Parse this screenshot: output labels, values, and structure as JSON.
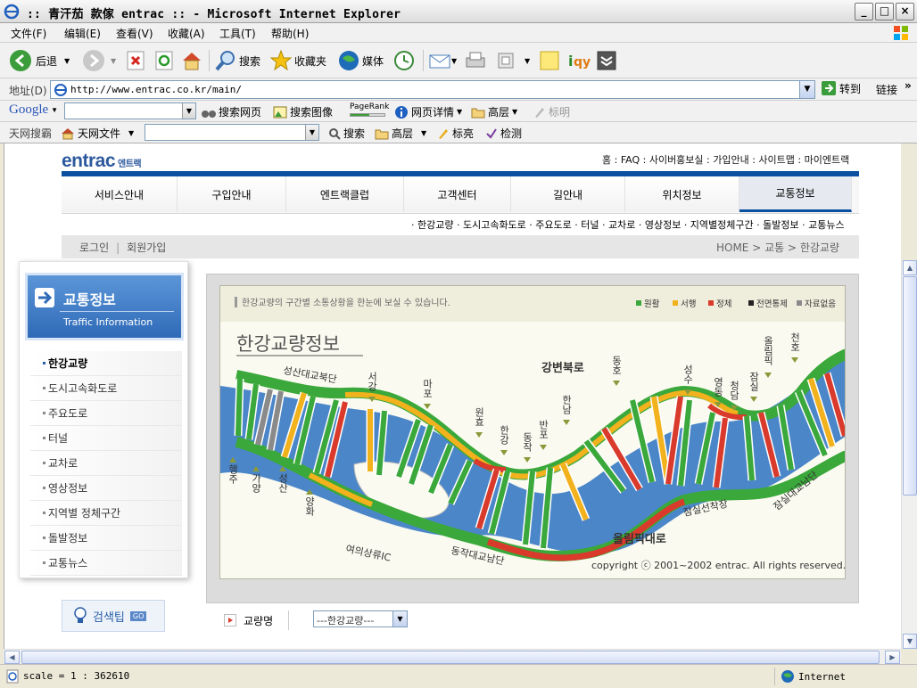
{
  "window": {
    "title": ":: 青汗茄 款傢 entrac :: - Microsoft Internet Explorer",
    "buttons": {
      "minimize": "_",
      "maximize": "□",
      "close": "×"
    }
  },
  "menu": [
    "文件(F)",
    "编辑(E)",
    "查看(V)",
    "收藏(A)",
    "工具(T)",
    "帮助(H)"
  ],
  "toolbar": {
    "back": "后退",
    "search": "搜索",
    "favorites": "收藏夹",
    "media": "媒体"
  },
  "address": {
    "label": "地址(D)",
    "url": "http://www.entrac.co.kr/main/",
    "go": "转到",
    "links": "链接"
  },
  "google_bar": {
    "brand": "Google",
    "search_web": "搜索网页",
    "search_images": "搜索图像",
    "pagerank": "PageRank",
    "page_info": "网页详情",
    "highlight": "高层",
    "bookmark": "标明"
  },
  "tianwang_bar": {
    "label": "天网搜霸",
    "files": "天网文件",
    "search": "搜索",
    "highlight": "高层",
    "mark": "标亮",
    "check": "检测"
  },
  "site": {
    "logo": "entrac",
    "logo_sub": "엔트랙",
    "top_links": "홈 : FAQ : 사이버홍보실 : 가입안내 : 사이트맵 : 마이엔트랙",
    "nav": [
      "서비스안내",
      "구입안내",
      "엔트랙클럽",
      "고객센터",
      "길안내",
      "위치정보",
      "교통정보"
    ],
    "active_nav": "교통정보",
    "subnav": "· 한강교량 · 도시고속화도로 · 주요도로 · 터널 · 교차로 · 영상정보 · 지역별정체구간 · 돌발정보 · 교통뉴스",
    "login": "로그인",
    "signup": "회원가입",
    "breadcrumb": "HOME > 교통 > 한강교량",
    "side_title_ko": "교통정보",
    "side_title_en": "Traffic Information",
    "side_items": [
      "한강교량",
      "도시고속화도로",
      "주요도로",
      "터널",
      "교차로",
      "영상정보",
      "지역별 정체구간",
      "돌발정보",
      "교통뉴스"
    ],
    "search_tip": "검색팁",
    "search_tip_go": "GO",
    "bridge_label": "교량명",
    "bridge_select": "---한강교량---"
  },
  "map": {
    "title": "한강교량정보",
    "intro": "한강교량의 구간별 소통상황을 한눈에 보실 수 있습니다.",
    "legend": [
      {
        "label": "원활",
        "color": "#3aa83a"
      },
      {
        "label": "서행",
        "color": "#f2b21d"
      },
      {
        "label": "정체",
        "color": "#d93a2b"
      },
      {
        "label": "전면통제",
        "color": "#222222"
      },
      {
        "label": "자료없음",
        "color": "#8a8a8a"
      }
    ],
    "roads": {
      "north_upper": "성산대교북단",
      "north_main": "강변북로",
      "south_main": "올림픽대로",
      "yeouido_ic": "여의상류IC",
      "dongjak_south": "동작대교남단",
      "jamsil_sun": "잠실선착장",
      "jamsil_south": "잠실대교남단"
    },
    "bridges": [
      "행주",
      "가양",
      "성산",
      "양화",
      "서강",
      "마포",
      "원효",
      "한강",
      "동작",
      "반포",
      "한남",
      "동호",
      "성수",
      "영동",
      "청담",
      "잠실",
      "올림픽",
      "천호"
    ],
    "copyright": "copyright ⓒ 2001~2002 entrac. All rights reserved."
  },
  "status": {
    "text": "scale = 1 : 362610",
    "zone": "Internet"
  }
}
